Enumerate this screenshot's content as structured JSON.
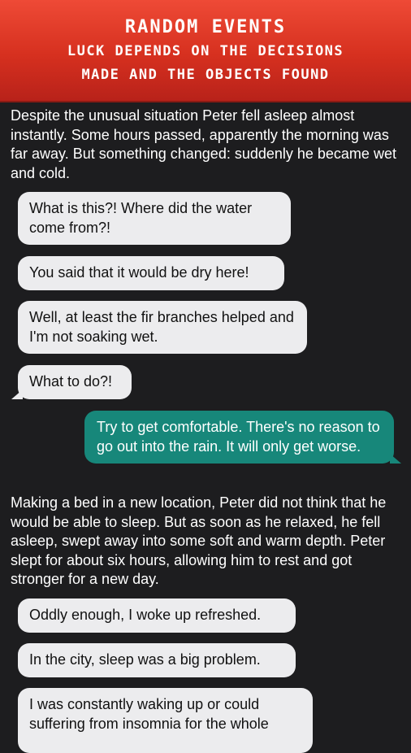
{
  "header": {
    "title": "Random events",
    "subtitle_line1": "Luck depends on the decisions",
    "subtitle_line2": "made and the objects found"
  },
  "story": {
    "narration1": "Despite the unusual situation Peter fell asleep almost instantly. Some hours passed, apparently the morning was far away. But something changed: suddenly he became wet and cold.",
    "msg1": "What is this?! Where did the water come from?!",
    "msg2": "You said that it would be dry here!",
    "msg3": "Well, at least the fir branches helped and I'm not soaking wet.",
    "msg4": "What to do?!",
    "choice1": "Try to get comfortable. There's no reason to go out into the rain. It will only get worse.",
    "narration2": "Making a bed in a new location, Peter did not think that he would be able to sleep. But as soon as he relaxed, he fell asleep, swept away into some soft and warm depth. Peter slept for about six hours, allowing him to rest and got stronger for a new day.",
    "msg5": "Oddly enough, I woke up refreshed.",
    "msg6": "In the city, sleep was a big problem.",
    "msg7": "I was constantly waking up or could suffering from insomnia for the whole"
  },
  "colors": {
    "banner": "#d6301f",
    "background": "#1d1d1f",
    "character_bubble": "#ececee",
    "player_bubble": "#17877a"
  }
}
